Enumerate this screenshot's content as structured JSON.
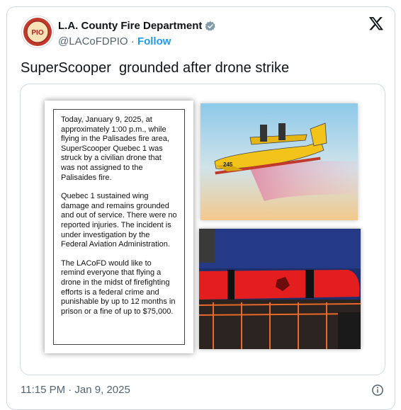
{
  "author": {
    "name": "L.A. County Fire Department",
    "handle": "@LACoFDPIO",
    "separator": "·",
    "follow_label": "Follow",
    "avatar_text": "PIO",
    "verified_color": "#829aab"
  },
  "tweet": {
    "text": "SuperScooper  grounded after drone strike",
    "timestamp": "11:15 PM · Jan 9, 2025"
  },
  "statement": {
    "paragraphs": [
      "Today, January 9, 2025, at approximately 1:00 p.m., while flying in the Palisades fire area, SuperScooper Quebec 1 was struck by a civilian drone that was not assigned to the Palisaides fire.",
      "Quebec 1 sustained wing damage and remains grounded and out of service. There were no reported injuries. The incident is under investigation by the Federal Aviation Administration.",
      "The LACoFD would like to remind everyone that flying a drone in the midst of firefighting efforts is a federal crime and punishable by up to 12 months in prison or a fine of up to $75,000."
    ]
  },
  "photos": {
    "plane_number": "245"
  },
  "colors": {
    "link": "#1d9bf0",
    "muted": "#536471",
    "border": "#cfd9de"
  },
  "icons": [
    "x-logo-icon",
    "verified-badge-icon",
    "info-icon"
  ]
}
